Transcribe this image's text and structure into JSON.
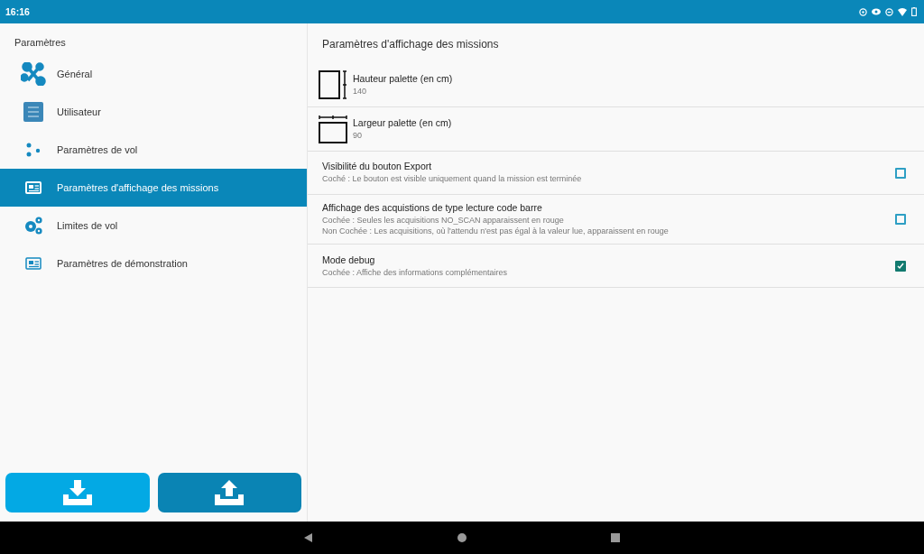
{
  "status_bar": {
    "time": "16:16"
  },
  "sidebar": {
    "title": "Paramètres",
    "items": [
      {
        "label": "Général",
        "selected": false
      },
      {
        "label": "Utilisateur",
        "selected": false
      },
      {
        "label": "Paramètres de vol",
        "selected": false
      },
      {
        "label": "Paramètres d'affichage des missions",
        "selected": true
      },
      {
        "label": "Limites de vol",
        "selected": false
      },
      {
        "label": "Paramètres de démonstration",
        "selected": false
      }
    ]
  },
  "content": {
    "title": "Paramètres d'affichage des missions",
    "settings": [
      {
        "kind": "height",
        "title": "Hauteur palette (en cm)",
        "summary": "140"
      },
      {
        "kind": "width",
        "title": "Largeur palette (en cm)",
        "summary": "90"
      },
      {
        "kind": "checkbox",
        "title": "Visibilité du bouton Export",
        "summary": "Coché : Le bouton est visible uniquement quand la mission est terminée",
        "checked": false
      },
      {
        "kind": "checkbox",
        "title": "Affichage des acquistions de type lecture code barre",
        "summary": "Cochée : Seules les acquisitions NO_SCAN apparaissent en rouge\nNon Cochée : Les acquisitions, où l'attendu n'est pas égal à la valeur lue, apparaissent en rouge",
        "checked": false
      },
      {
        "kind": "checkbox",
        "title": "Mode debug",
        "summary": "Cochée : Affiche des informations complémentaires",
        "checked": true
      }
    ]
  }
}
